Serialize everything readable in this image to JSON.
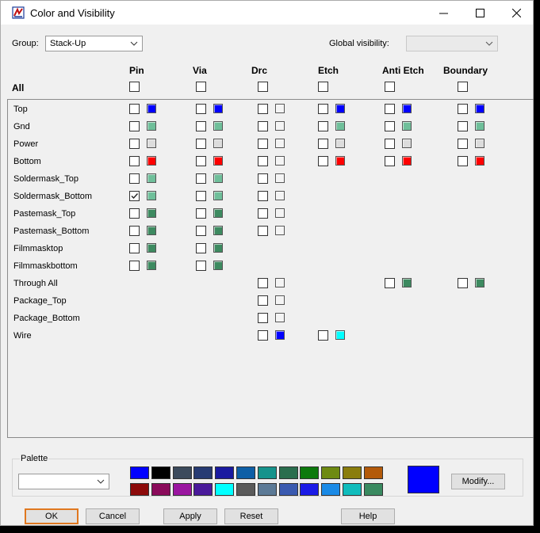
{
  "window": {
    "title": "Color and Visibility"
  },
  "group": {
    "label": "Group:",
    "value": "Stack-Up"
  },
  "global_visibility": {
    "label": "Global visibility:",
    "value": ""
  },
  "all_label": "All",
  "columns": [
    "Pin",
    "Via",
    "Drc",
    "Etch",
    "Anti Etch",
    "Boundary"
  ],
  "rows": [
    {
      "name": "Top",
      "cells": [
        {
          "on": false,
          "color": "#0000ff"
        },
        {
          "on": false,
          "color": "#0000ff"
        },
        {
          "on": false,
          "color": "#f4f4f4"
        },
        {
          "on": false,
          "color": "#0000ff"
        },
        {
          "on": false,
          "color": "#0000ff"
        },
        {
          "on": false,
          "color": "#0000ff"
        }
      ]
    },
    {
      "name": "Gnd",
      "cells": [
        {
          "on": false,
          "color": "#6fbf9a"
        },
        {
          "on": false,
          "color": "#6fbf9a"
        },
        {
          "on": false,
          "color": "#f4f4f4"
        },
        {
          "on": false,
          "color": "#6fbf9a"
        },
        {
          "on": false,
          "color": "#6fbf9a"
        },
        {
          "on": false,
          "color": "#6fbf9a"
        }
      ]
    },
    {
      "name": "Power",
      "cells": [
        {
          "on": false,
          "color": "#dcdcdc"
        },
        {
          "on": false,
          "color": "#dcdcdc"
        },
        {
          "on": false,
          "color": "#f4f4f4"
        },
        {
          "on": false,
          "color": "#dcdcdc"
        },
        {
          "on": false,
          "color": "#dcdcdc"
        },
        {
          "on": false,
          "color": "#dcdcdc"
        }
      ]
    },
    {
      "name": "Bottom",
      "cells": [
        {
          "on": false,
          "color": "#ff0000"
        },
        {
          "on": false,
          "color": "#ff0000"
        },
        {
          "on": false,
          "color": "#f4f4f4"
        },
        {
          "on": false,
          "color": "#ff0000"
        },
        {
          "on": false,
          "color": "#ff0000"
        },
        {
          "on": false,
          "color": "#ff0000"
        }
      ]
    },
    {
      "name": "Soldermask_Top",
      "cells": [
        {
          "on": false,
          "color": "#6fbf9a"
        },
        {
          "on": false,
          "color": "#6fbf9a"
        },
        {
          "on": false,
          "color": "#f4f4f4"
        },
        null,
        null,
        null
      ]
    },
    {
      "name": "Soldermask_Bottom",
      "cells": [
        {
          "on": true,
          "color": "#6fbf9a"
        },
        {
          "on": false,
          "color": "#6fbf9a"
        },
        {
          "on": false,
          "color": "#f4f4f4"
        },
        null,
        null,
        null
      ]
    },
    {
      "name": "Pastemask_Top",
      "cells": [
        {
          "on": false,
          "color": "#3d8a60"
        },
        {
          "on": false,
          "color": "#3d8a60"
        },
        {
          "on": false,
          "color": "#f4f4f4"
        },
        null,
        null,
        null
      ]
    },
    {
      "name": "Pastemask_Bottom",
      "cells": [
        {
          "on": false,
          "color": "#3d8a60"
        },
        {
          "on": false,
          "color": "#3d8a60"
        },
        {
          "on": false,
          "color": "#f4f4f4"
        },
        null,
        null,
        null
      ]
    },
    {
      "name": "Filmmasktop",
      "cells": [
        {
          "on": false,
          "color": "#3d8a60"
        },
        {
          "on": false,
          "color": "#3d8a60"
        },
        null,
        null,
        null,
        null
      ]
    },
    {
      "name": "Filmmaskbottom",
      "cells": [
        {
          "on": false,
          "color": "#3d8a60"
        },
        {
          "on": false,
          "color": "#3d8a60"
        },
        null,
        null,
        null,
        null
      ]
    },
    {
      "name": "Through All",
      "cells": [
        null,
        null,
        {
          "on": false,
          "color": "#f4f4f4"
        },
        null,
        {
          "on": false,
          "color": "#3d8a60"
        },
        {
          "on": false,
          "color": "#3d8a60"
        }
      ]
    },
    {
      "name": "Package_Top",
      "cells": [
        null,
        null,
        {
          "on": false,
          "color": "#f4f4f4"
        },
        null,
        null,
        null
      ]
    },
    {
      "name": "Package_Bottom",
      "cells": [
        null,
        null,
        {
          "on": false,
          "color": "#f4f4f4"
        },
        null,
        null,
        null
      ]
    },
    {
      "name": "Wire",
      "cells": [
        null,
        null,
        {
          "on": false,
          "color": "#0000ff"
        },
        {
          "on": false,
          "color": "#00ffff"
        },
        null,
        null
      ]
    }
  ],
  "palette": {
    "label": "Palette",
    "dropdown_value": "",
    "colors_row1": [
      "#0000ff",
      "#000000",
      "#3c4a5c",
      "#273b73",
      "#1a1aa0",
      "#0e5fa6",
      "#16938c",
      "#2a6e4e",
      "#0d7a0d",
      "#6e8a12",
      "#8a7d0d",
      "#b35a0a"
    ],
    "colors_row2": [
      "#8c0a0a",
      "#8a0a5a",
      "#9a16a0",
      "#4a1a9a",
      "#00ffff",
      "#5a5a5a",
      "#5c7a96",
      "#3a5ab0",
      "#1a1ae6",
      "#1a8ae6",
      "#10bcbc",
      "#3a8a60"
    ],
    "current_color": "#0000ff",
    "modify_label": "Modify..."
  },
  "buttons": {
    "ok": "OK",
    "cancel": "Cancel",
    "apply": "Apply",
    "reset": "Reset",
    "help": "Help"
  }
}
